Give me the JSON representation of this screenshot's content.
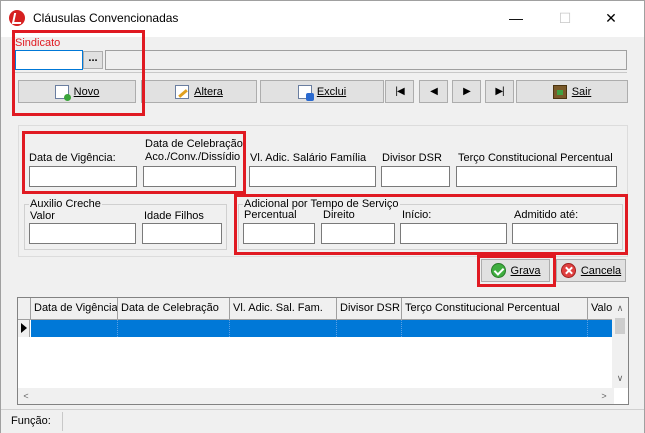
{
  "window": {
    "title": "Cláusulas Convencionadas",
    "minimize_glyph": "—",
    "maximize_glyph": "☐",
    "close_glyph": "✕"
  },
  "sindicato": {
    "label": "Sindicato",
    "value": "",
    "lookup_label": "..."
  },
  "toolbar": {
    "novo": "Novo",
    "altera": "Altera",
    "exclui": "Exclui",
    "first": "|◀",
    "prev": "◀",
    "next": "▶",
    "last": "▶|",
    "sair": "Sair"
  },
  "form": {
    "data_vigencia": {
      "label": "Data de Vigência:",
      "value": ""
    },
    "data_celebracao": {
      "label_line1": "Data de Celebração",
      "label_line2": "Aco./Conv./Dissídio",
      "value": ""
    },
    "vl_adic_salario_familia": {
      "label": "Vl. Adic. Salário Família",
      "value": ""
    },
    "divisor_dsr": {
      "label": "Divisor DSR",
      "value": ""
    },
    "terco_constitucional": {
      "label": "Terço Constitucional Percentual",
      "value": ""
    },
    "auxilio_creche": {
      "caption": "Auxilio Creche",
      "valor": {
        "label": "Valor",
        "value": ""
      },
      "idade_filhos": {
        "label": "Idade Filhos",
        "value": ""
      }
    },
    "adicional_tempo": {
      "caption": "Adicional por Tempo de Serviço",
      "percentual": {
        "label": "Percentual",
        "value": ""
      },
      "direito": {
        "label": "Direito",
        "value": ""
      },
      "inicio": {
        "label": "Início:",
        "value": ""
      },
      "admitido_ate": {
        "label": "Admitido até:",
        "value": ""
      }
    }
  },
  "actions": {
    "grava": "Grava",
    "cancela": "Cancela"
  },
  "grid": {
    "columns": [
      "Data de Vigência",
      "Data de Celebração",
      "Vl. Adic. Sal. Fam.",
      "Divisor DSR",
      "Terço Constitucional Percentual",
      "Valo"
    ],
    "selection_color": "#0078d7"
  },
  "status": {
    "funcao_label": "Função:"
  },
  "colors": {
    "highlight_red": "#e01a22",
    "window_bg": "#f0f0f0"
  }
}
